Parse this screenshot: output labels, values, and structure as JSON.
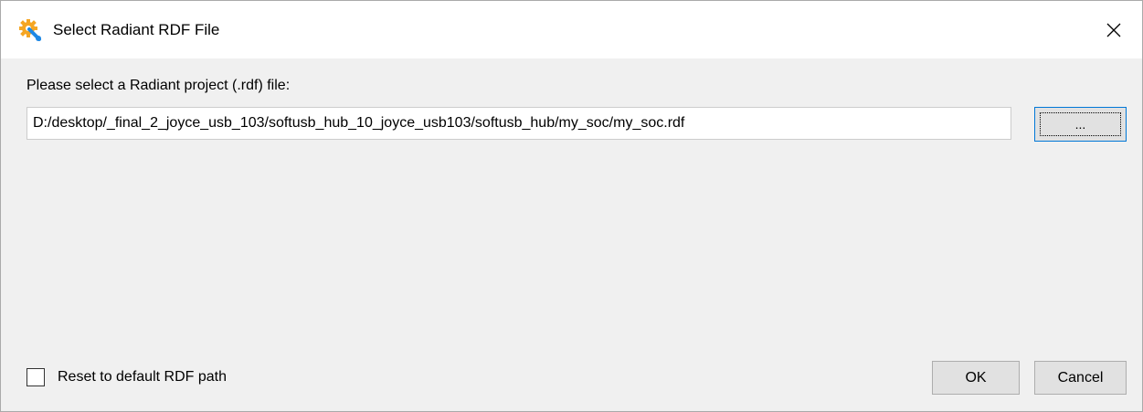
{
  "window": {
    "title": "Select Radiant RDF File",
    "app_icon": "gear-wrench-icon",
    "close_icon": "close-icon"
  },
  "dialog": {
    "prompt": "Please select a Radiant project (.rdf) file:",
    "path_value": "D:/desktop/_final_2_joyce_usb_103/softusb_hub_10_joyce_usb103/softusb_hub/my_soc/my_soc.rdf",
    "browse_label": "...",
    "reset_checkbox_label": "Reset to default RDF path",
    "reset_checked": false,
    "ok_label": "OK",
    "cancel_label": "Cancel"
  },
  "colors": {
    "accent": "#0078d7",
    "icon_orange": "#f5a623",
    "icon_blue": "#1e88e5"
  }
}
